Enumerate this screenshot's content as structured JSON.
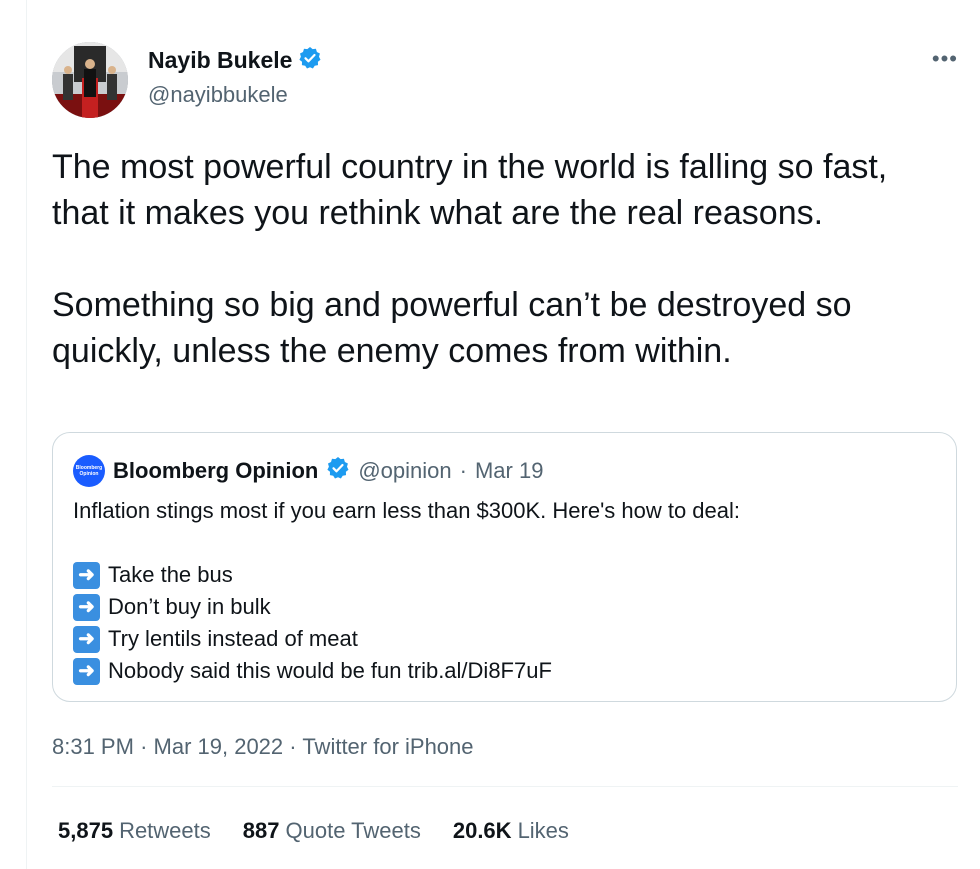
{
  "colors": {
    "verified": "#1d9bf0",
    "text": "#0f1419",
    "secondary": "#536471",
    "border": "#cfd9de"
  },
  "author": {
    "name": "Nayib Bukele",
    "handle": "@nayibbukele",
    "verified_icon": "verified-badge-icon",
    "avatar_icon": "avatar"
  },
  "more_label": "•••",
  "tweet": {
    "text": "The most powerful country in the world is falling so fast, that it makes you rethink what are the real reasons.\n\nSomething so big and powerful can’t be destroyed so quickly, unless the enemy comes from within."
  },
  "quote": {
    "logo_text_1": "Bloomberg",
    "logo_text_2": "Opinion",
    "name": "Bloomberg Opinion",
    "handle": "@opinion",
    "separator": "·",
    "date": "Mar 19",
    "intro": "Inflation stings most if you earn less than $300K. Here's how to deal:",
    "arrow_glyph": "➜",
    "items": [
      "Take the bus",
      "Don’t buy in bulk",
      "Try lentils instead of meat",
      "Nobody said this would be fun trib.al/Di8F7uF"
    ]
  },
  "meta": {
    "time": "8:31 PM",
    "separator": "·",
    "date": "Mar 19, 2022",
    "source": "Twitter for iPhone"
  },
  "stats": {
    "retweets_count": "5,875",
    "retweets_label": "Retweets",
    "quotes_count": "887",
    "quotes_label": "Quote Tweets",
    "likes_count": "20.6K",
    "likes_label": "Likes"
  }
}
